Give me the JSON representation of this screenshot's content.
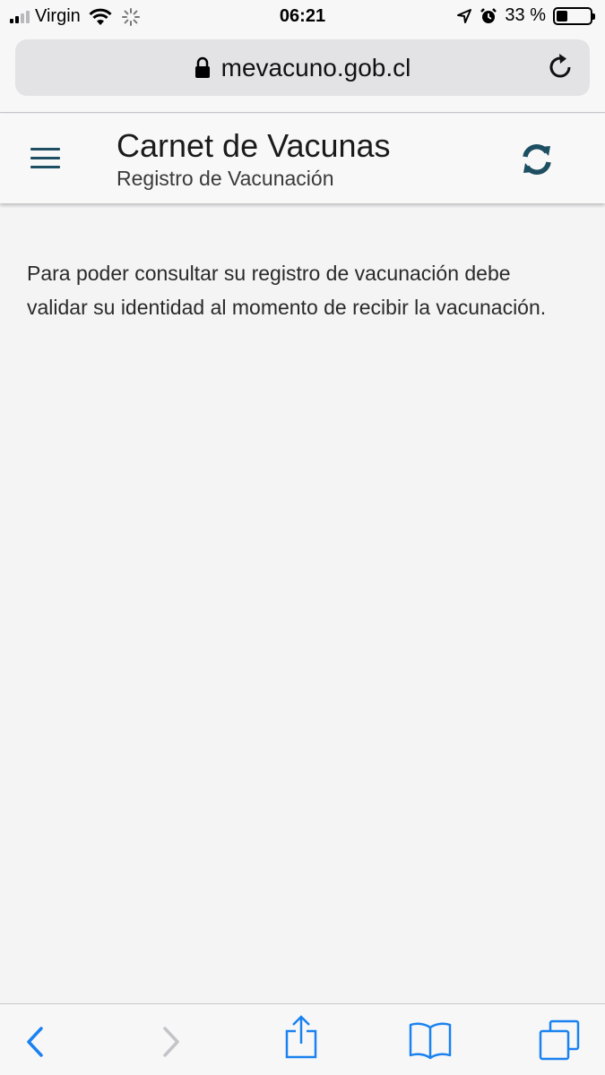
{
  "status_bar": {
    "carrier": "Virgin",
    "time": "06:21",
    "battery_percent": "33 %",
    "battery_level": 0.33,
    "signal_bars_active": 2
  },
  "browser": {
    "url": "mevacuno.gob.cl"
  },
  "header": {
    "title": "Carnet de Vacunas",
    "subtitle": "Registro de Vacunación"
  },
  "main": {
    "message": "Para poder consultar su registro de vacunación debe validar su identidad al momento de recibir la vacunación."
  },
  "icons": {
    "menu": "hamburger-menu-icon",
    "sync": "sync-icon",
    "lock": "lock-icon",
    "reload": "reload-icon",
    "back": "back-icon",
    "forward": "forward-icon",
    "share": "share-icon",
    "bookmarks": "bookmarks-icon",
    "tabs": "tabs-icon"
  },
  "colors": {
    "accent": "#1d4e62",
    "safari_blue": "#1a82f0",
    "disabled": "#c4c4c8"
  }
}
